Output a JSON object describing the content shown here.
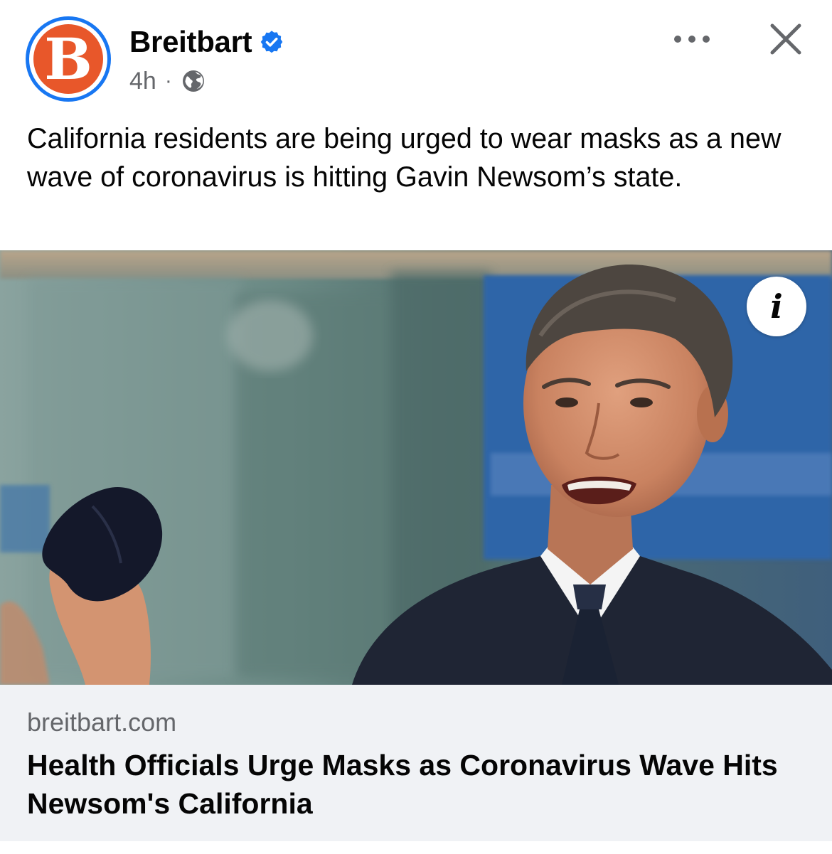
{
  "post": {
    "page_name": "Breitbart",
    "avatar_letter": "B",
    "timestamp": "4h",
    "separator": "·",
    "audience_icon": "globe-icon",
    "verified_icon": "verified-badge-icon",
    "text": "California residents are being urged to wear masks as a new wave of coronavirus is hitting Gavin Newsom’s state."
  },
  "header_actions": {
    "more_icon": "more-options-icon",
    "close_icon": "close-icon"
  },
  "link_preview": {
    "info_label": "i",
    "domain": "breitbart.com",
    "title": "Health Officials Urge Masks as Coronavirus Wave Hits Newsom's California"
  },
  "colors": {
    "verified_blue": "#1877f2",
    "brand_orange": "#e8572a",
    "meta_gray": "#65676b",
    "link_footer_bg": "#f0f2f5"
  }
}
